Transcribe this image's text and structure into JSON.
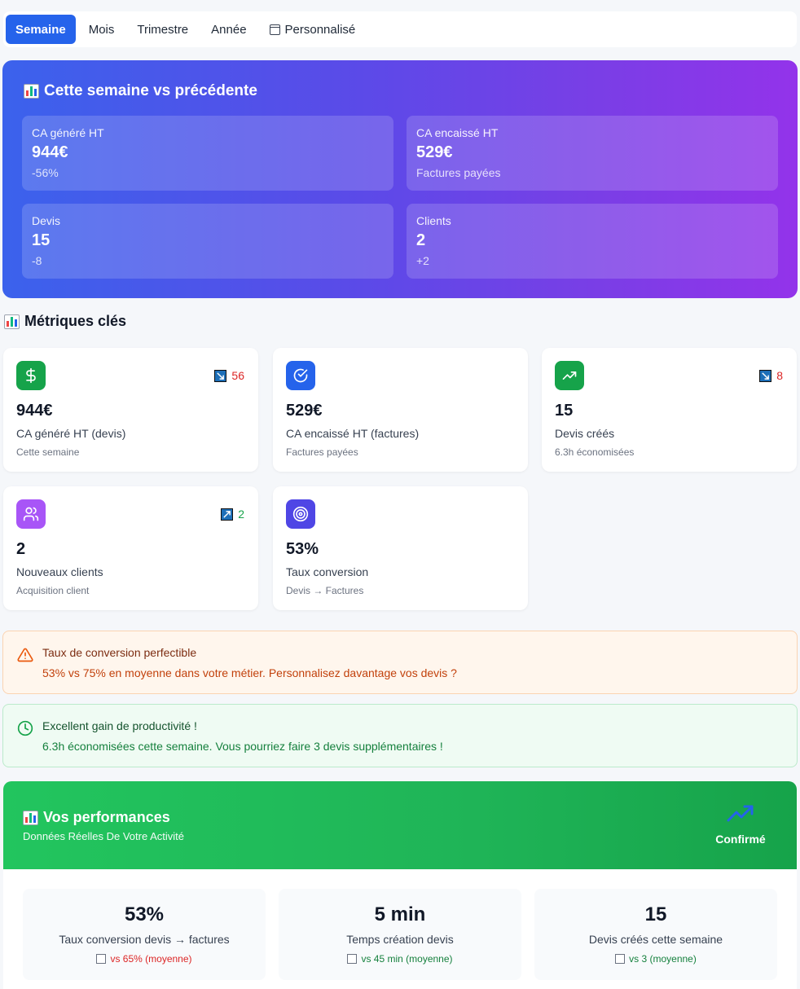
{
  "tabs": [
    {
      "label": "Semaine",
      "active": true
    },
    {
      "label": "Mois"
    },
    {
      "label": "Trimestre"
    },
    {
      "label": "Année"
    },
    {
      "label": "Personnalisé"
    }
  ],
  "week": {
    "title": "Cette semaine vs précédente",
    "cards": [
      {
        "label": "CA généré HT",
        "value": "944€",
        "sub": "-56%"
      },
      {
        "label": "CA encaissé HT",
        "value": "529€",
        "sub": "Factures payées"
      },
      {
        "label": "Devis",
        "value": "15",
        "sub": "-8"
      },
      {
        "label": "Clients",
        "value": "2",
        "sub": "+2"
      }
    ]
  },
  "metrics": {
    "title": "Métriques clés",
    "cards": [
      {
        "icon": "dollar-icon",
        "color": "#16a34a",
        "trend": "56",
        "trend_dir": "down",
        "value": "944€",
        "label": "CA généré HT (devis)",
        "sub": "Cette semaine"
      },
      {
        "icon": "check-circle-icon",
        "color": "#2563eb",
        "trend": "",
        "value": "529€",
        "label": "CA encaissé HT (factures)",
        "sub": "Factures payées"
      },
      {
        "icon": "trending-up-icon",
        "color": "#16a34a",
        "trend": "8",
        "trend_dir": "down",
        "value": "15",
        "label": "Devis créés",
        "sub": "6.3h économisées"
      },
      {
        "icon": "users-icon",
        "color": "#a855f7",
        "trend": "2",
        "trend_dir": "up",
        "value": "2",
        "label": "Nouveaux clients",
        "sub": "Acquisition client"
      },
      {
        "icon": "target-icon",
        "color": "#4f46e5",
        "trend": "",
        "value": "53%",
        "label": "Taux conversion",
        "sub": "Devis → Factures"
      }
    ]
  },
  "alerts": {
    "warning": {
      "title": "Taux de conversion perfectible",
      "body": "53% vs 75% en moyenne dans votre métier. Personnalisez davantage vos devis ?"
    },
    "success": {
      "title": "Excellent gain de productivité !",
      "body": "6.3h économisées cette semaine. Vous pourriez faire 3 devis supplémentaires !"
    }
  },
  "performance": {
    "title": "Vos performances",
    "subtitle": "Données Réelles De Votre Activité",
    "badge": "Confirmé",
    "stats": [
      {
        "value": "53%",
        "label": "Taux conversion devis → factures",
        "compare": "vs 65% (moyenne)",
        "tone": "red"
      },
      {
        "value": "5 min",
        "label": "Temps création devis",
        "compare": "vs 45 min (moyenne)",
        "tone": "green"
      },
      {
        "value": "15",
        "label": "Devis créés cette semaine",
        "compare": "vs 3 (moyenne)",
        "tone": "green"
      }
    ]
  }
}
